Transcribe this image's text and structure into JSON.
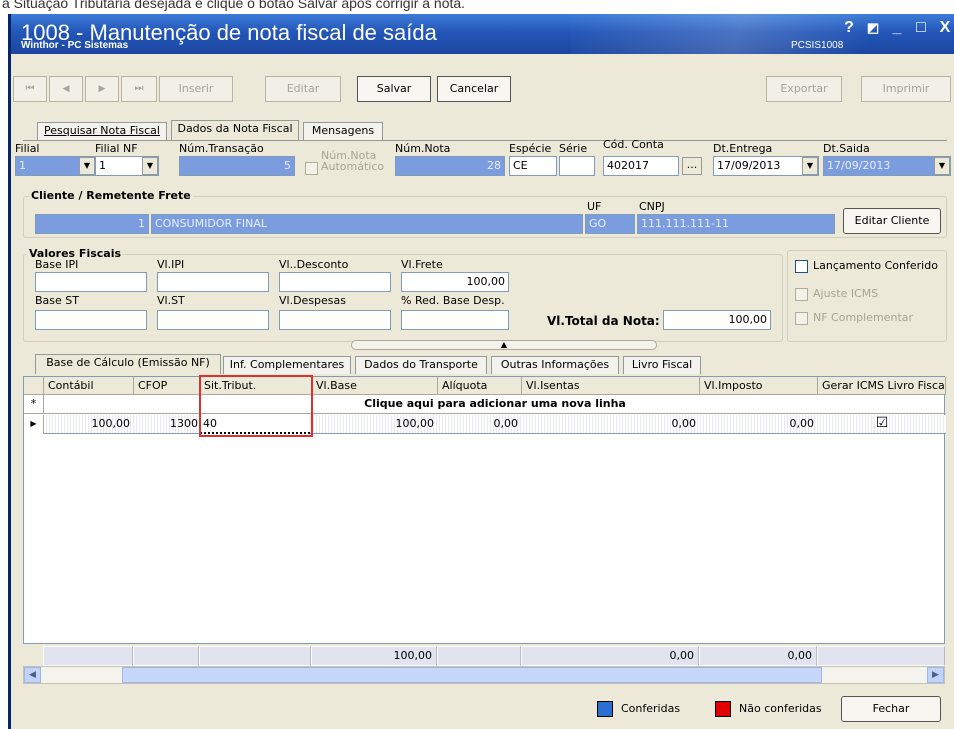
{
  "doc_fragment": "a Situação Tributária desejada e clique o botão Salvar após corrigir a nota.",
  "window": {
    "title": "1008 - Manutenção de nota fiscal de saída",
    "subtitle": "Winthor - PC Sistemas",
    "code": "PCSIS1008",
    "buttons": [
      "?",
      "◩",
      "_",
      "□",
      "X"
    ]
  },
  "toolbar": {
    "first": "⏮",
    "prev": "◀",
    "next": "▶",
    "last": "⏭",
    "insert": "Inserir",
    "edit": "Editar",
    "save": "Salvar",
    "cancel": "Cancelar",
    "export": "Exportar",
    "print": "Imprimir"
  },
  "tabs": [
    "Pesquisar Nota Fiscal",
    "Dados da Nota Fiscal",
    "Mensagens"
  ],
  "header": {
    "filial_label": "Filial",
    "filial_value": "1",
    "filialnf_label": "Filial NF",
    "filialnf_value": "1",
    "transacao_label": "Núm.Transação",
    "transacao_value": "5",
    "numnota_auto_label": "Núm.Nota Automático",
    "numnota_label": "Núm.Nota",
    "numnota_value": "28",
    "especie_label": "Espécie",
    "especie_value": "CE",
    "serie_label": "Série",
    "serie_value": "",
    "conta_label": "Cód. Conta",
    "conta_value": "402017",
    "conta_btn": "...",
    "dtentrega_label": "Dt.Entrega",
    "dtentrega_value": "17/09/2013",
    "dtsaida_label": "Dt.Saida",
    "dtsaida_value": "17/09/2013"
  },
  "cliente": {
    "group_title": "Cliente / Remetente Frete",
    "code": "1",
    "name": "CONSUMIDOR FINAL",
    "uf_label": "UF",
    "uf_value": "GO",
    "cnpj_label": "CNPJ",
    "cnpj_value": "111.111.111-11",
    "edit_button": "Editar Cliente"
  },
  "fiscais": {
    "group_title": "Valores Fiscais",
    "base_ipi": "Base IPI",
    "vl_ipi": "Vl.IPI",
    "vl_desconto": "Vl..Desconto",
    "vl_frete": "Vl.Frete",
    "vl_frete_value": "100,00",
    "base_st": "Base ST",
    "vl_st": "Vl.ST",
    "vl_despesas": "Vl.Despesas",
    "red_base": "% Red. Base Desp.",
    "total_label": "Vl.Total da Nota:",
    "total_value": "100,00"
  },
  "checks": {
    "lancamento": "Lançamento Conferido",
    "ajuste": "Ajuste ICMS",
    "nf_compl": "NF Complementar"
  },
  "subtabs": [
    "Base de Cálculo (Emissão NF)",
    "Inf. Complementares",
    "Dados do Transporte",
    "Outras Informações",
    "Livro Fiscal"
  ],
  "grid": {
    "columns": [
      "Contábil",
      "CFOP",
      "Sit.Tribut.",
      "Vl.Base",
      "Alíquota",
      "Vl.Isentas",
      "Vl.Imposto",
      "Gerar ICMS Livro Fiscal"
    ],
    "new_row_text": "Clique aqui para adicionar uma nova linha",
    "new_row_marker": "*",
    "row_marker": "▶",
    "rows": [
      {
        "contabil": "100,00",
        "cfop": "1300",
        "sit": "40",
        "base": "100,00",
        "aliquota": "0,00",
        "isentas": "0,00",
        "imposto": "0,00",
        "gerar": "☑"
      }
    ],
    "totals": {
      "base": "100,00",
      "isentas": "0,00",
      "imposto": "0,00"
    }
  },
  "footer": {
    "legend_ok": "Conferidas",
    "legend_ok_color": "#2a6fd1",
    "legend_no": "Não conferidas",
    "legend_no_color": "#e00000",
    "close": "Fechar"
  },
  "highlight_color": "#e0302e"
}
